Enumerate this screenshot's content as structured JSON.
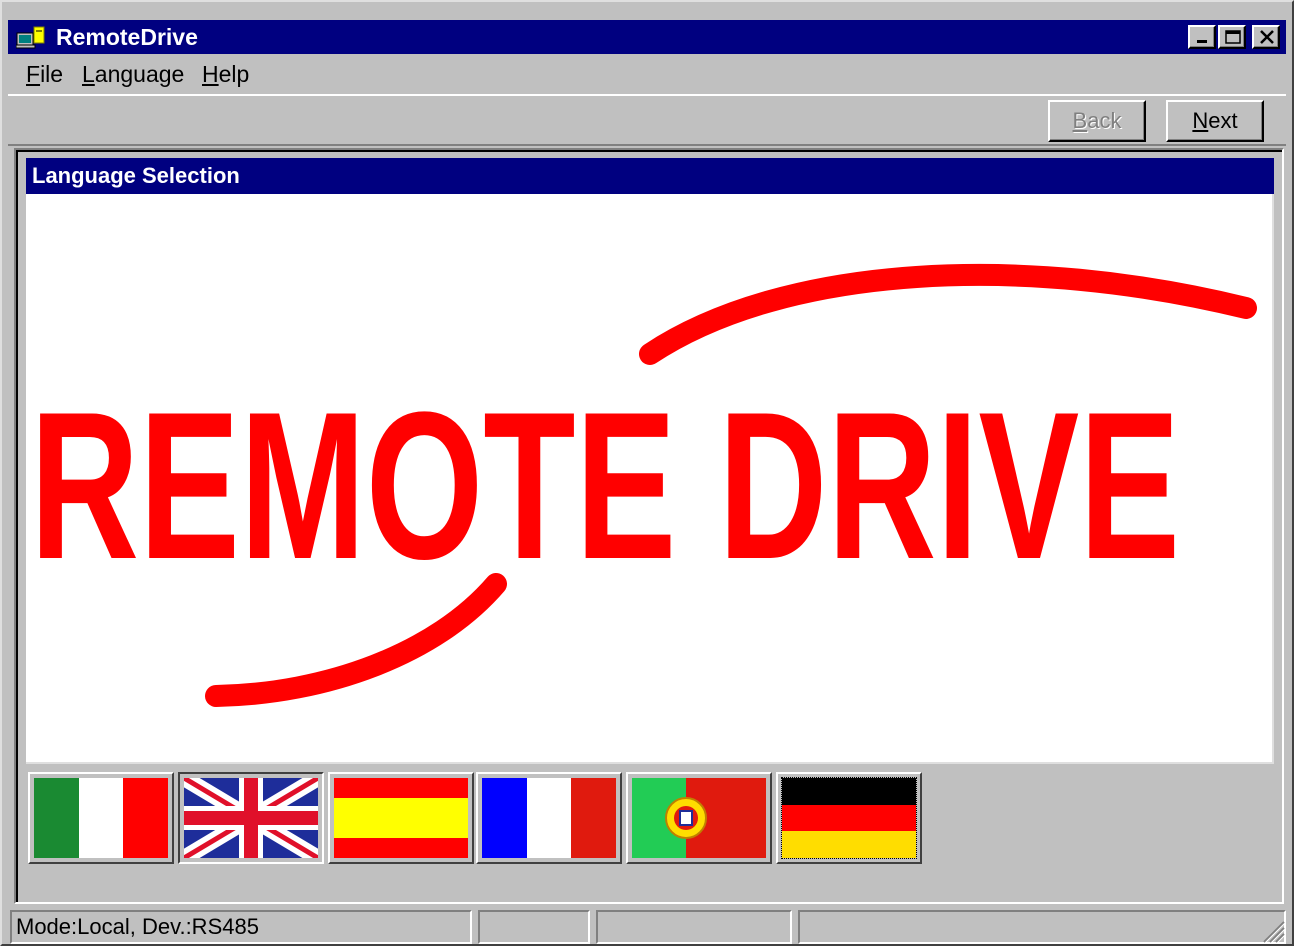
{
  "window": {
    "title": "RemoteDrive",
    "icons": {
      "app": "app-computer-icon",
      "minimize": "minimize-icon",
      "maximize": "maximize-icon",
      "close": "close-icon"
    }
  },
  "menu": {
    "file": {
      "mnemonic": "F",
      "rest": "ile"
    },
    "language": {
      "mnemonic": "L",
      "rest": "anguage"
    },
    "help": {
      "mnemonic": "H",
      "rest": "elp"
    }
  },
  "toolbar": {
    "back": {
      "mnemonic": "B",
      "rest": "ack",
      "enabled": false
    },
    "next": {
      "mnemonic": "N",
      "rest": "ext",
      "enabled": true
    }
  },
  "section": {
    "title": "Language Selection"
  },
  "logo": {
    "text": "REMOTE DRIVE",
    "color": "#ff0000"
  },
  "languages": [
    {
      "flag": "italy-flag-icon",
      "selected": false
    },
    {
      "flag": "uk-flag-icon",
      "selected": true
    },
    {
      "flag": "spain-flag-icon",
      "selected": false
    },
    {
      "flag": "france-flag-icon",
      "selected": false
    },
    {
      "flag": "portugal-flag-icon",
      "selected": false
    },
    {
      "flag": "germany-flag-icon",
      "selected": false,
      "focused": true
    }
  ],
  "status": {
    "mode": "Mode:Local, Dev.:RS485",
    "cell2": "",
    "cell3": "",
    "cell4": ""
  },
  "colors": {
    "titlebar": "#000080",
    "face": "#c0c0c0",
    "accent": "#ff0000"
  }
}
